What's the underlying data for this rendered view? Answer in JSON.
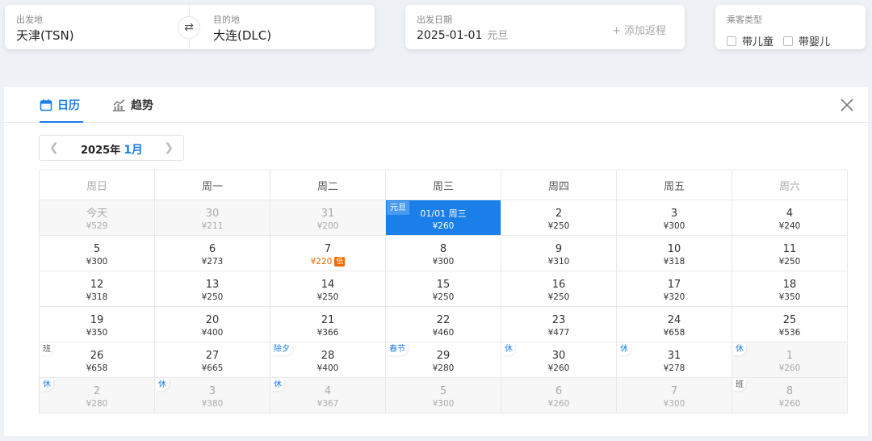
{
  "search": {
    "origin": {
      "label": "出发地",
      "value": "天津(TSN)"
    },
    "destination": {
      "label": "目的地",
      "value": "大连(DLC)"
    },
    "swap_icon": "⇄",
    "depart": {
      "label": "出发日期",
      "value": "2025-01-01",
      "holiday": "元旦"
    },
    "add_return": "+ 添加返程",
    "passenger": {
      "label": "乘客类型",
      "options": [
        "带儿童",
        "带婴儿"
      ]
    }
  },
  "calendar": {
    "tabs": [
      {
        "label": "日历",
        "icon": "calendar-icon"
      },
      {
        "label": "趋势",
        "icon": "trend-chart-icon"
      }
    ],
    "year": "2025年",
    "month": "1月",
    "weekdays": [
      "周日",
      "周一",
      "周二",
      "周三",
      "周四",
      "周五",
      "周六"
    ],
    "accent": "#1a7fe8",
    "low_color": "#f06a00",
    "weeks": [
      [
        {
          "day": "今天",
          "price": "¥529",
          "dim": true
        },
        {
          "day": "30",
          "price": "¥211",
          "dim": true
        },
        {
          "day": "31",
          "price": "¥200",
          "dim": true
        },
        {
          "day": "01/01 周三",
          "price": "¥260",
          "selected": true,
          "tag": "元旦"
        },
        {
          "day": "2",
          "price": "¥250"
        },
        {
          "day": "3",
          "price": "¥300"
        },
        {
          "day": "4",
          "price": "¥240"
        }
      ],
      [
        {
          "day": "5",
          "price": "¥300"
        },
        {
          "day": "6",
          "price": "¥273"
        },
        {
          "day": "7",
          "price": "¥220",
          "low": "低"
        },
        {
          "day": "8",
          "price": "¥300"
        },
        {
          "day": "9",
          "price": "¥310"
        },
        {
          "day": "10",
          "price": "¥318"
        },
        {
          "day": "11",
          "price": "¥250"
        }
      ],
      [
        {
          "day": "12",
          "price": "¥318"
        },
        {
          "day": "13",
          "price": "¥250"
        },
        {
          "day": "14",
          "price": "¥250"
        },
        {
          "day": "15",
          "price": "¥250"
        },
        {
          "day": "16",
          "price": "¥250"
        },
        {
          "day": "17",
          "price": "¥320"
        },
        {
          "day": "18",
          "price": "¥350"
        }
      ],
      [
        {
          "day": "19",
          "price": "¥350"
        },
        {
          "day": "20",
          "price": "¥400"
        },
        {
          "day": "21",
          "price": "¥366"
        },
        {
          "day": "22",
          "price": "¥460"
        },
        {
          "day": "23",
          "price": "¥477"
        },
        {
          "day": "24",
          "price": "¥658"
        },
        {
          "day": "25",
          "price": "¥536"
        }
      ],
      [
        {
          "day": "26",
          "price": "¥658",
          "tag": "班",
          "tag_type": "ban"
        },
        {
          "day": "27",
          "price": "¥665"
        },
        {
          "day": "28",
          "price": "¥400",
          "tag": "除夕"
        },
        {
          "day": "29",
          "price": "¥280",
          "tag": "春节"
        },
        {
          "day": "30",
          "price": "¥260",
          "tag": "休"
        },
        {
          "day": "31",
          "price": "¥278",
          "tag": "休"
        },
        {
          "day": "1",
          "price": "¥260",
          "dim": true,
          "tag": "休"
        }
      ],
      [
        {
          "day": "2",
          "price": "¥280",
          "dim": true,
          "tag": "休"
        },
        {
          "day": "3",
          "price": "¥380",
          "dim": true,
          "tag": "休"
        },
        {
          "day": "4",
          "price": "¥367",
          "dim": true,
          "tag": "休"
        },
        {
          "day": "5",
          "price": "¥300",
          "dim": true
        },
        {
          "day": "6",
          "price": "¥260",
          "dim": true
        },
        {
          "day": "7",
          "price": "¥300",
          "dim": true
        },
        {
          "day": "8",
          "price": "¥260",
          "dim": true,
          "tag": "班",
          "tag_type": "ban"
        }
      ]
    ]
  }
}
